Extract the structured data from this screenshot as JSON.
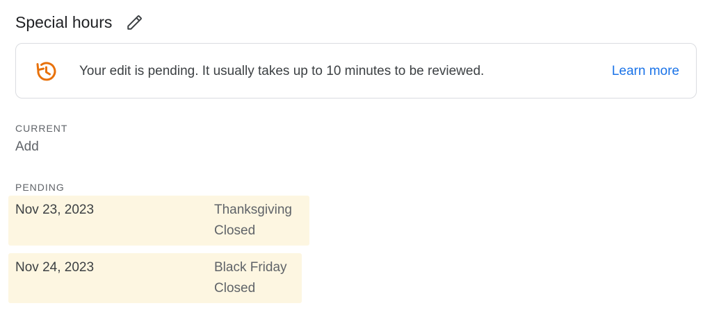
{
  "section": {
    "title": "Special hours",
    "edit_icon": "pencil-icon"
  },
  "notice": {
    "icon": "pending-clock-icon",
    "icon_color": "#e8710a",
    "message": "Your edit is pending. It usually takes up to 10 minutes to be reviewed.",
    "link_label": "Learn more",
    "link_color": "#1a73e8"
  },
  "current": {
    "label": "CURRENT",
    "value": "Add"
  },
  "pending": {
    "label": "PENDING",
    "highlight_color": "#fdf6e1",
    "items": [
      {
        "date": "Nov 23, 2023",
        "name": "Thanksgiving",
        "status": "Closed"
      },
      {
        "date": "Nov 24, 2023",
        "name": "Black Friday",
        "status": "Closed"
      }
    ]
  }
}
